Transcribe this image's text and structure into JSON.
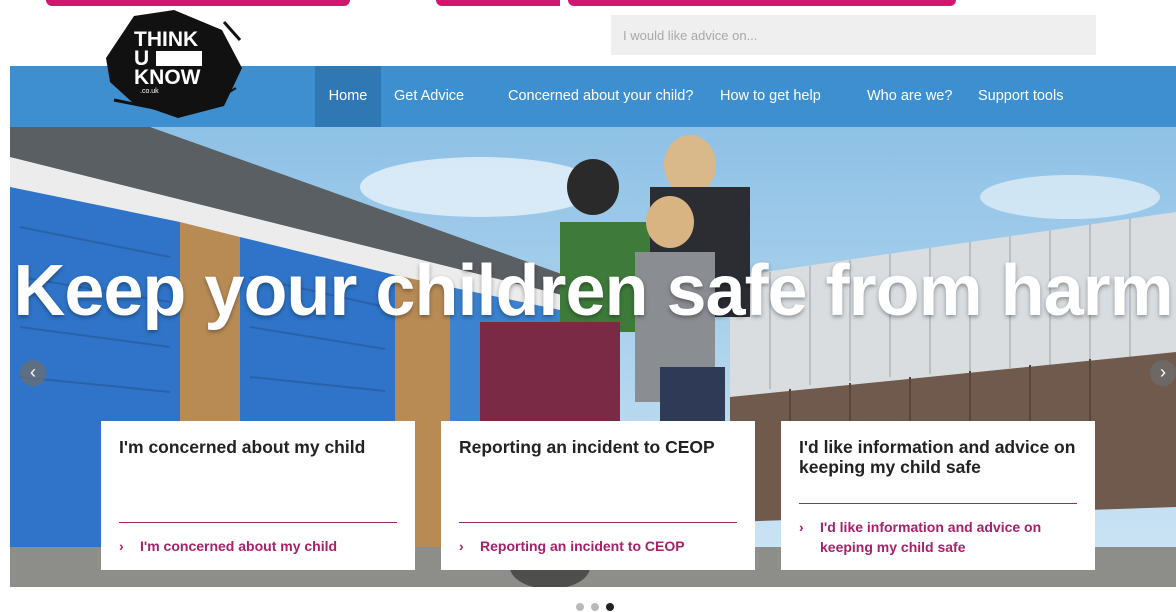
{
  "colors": {
    "nav_bg": "#3d8fd0",
    "nav_active": "#2f78b3",
    "accent": "#a6206a",
    "brand_pink": "#d0166f"
  },
  "logo": {
    "line1": "THINK",
    "line2": "U",
    "line3": "KNOW",
    "domain": ".co.uk",
    "icon": "thinkuknow-logo"
  },
  "search": {
    "placeholder": "I would like advice on..."
  },
  "nav": {
    "items": [
      {
        "label": "Home",
        "active": true
      },
      {
        "label": "Get Advice"
      },
      {
        "label": "Concerned about your child?"
      },
      {
        "label": "How to get help"
      },
      {
        "label": "Who are we?"
      },
      {
        "label": "Support tools"
      }
    ]
  },
  "hero": {
    "title": "Keep your children safe from harm",
    "prev_icon": "chevron-left-icon",
    "next_icon": "chevron-right-icon",
    "prev_glyph": "‹",
    "next_glyph": "›"
  },
  "cards": [
    {
      "title": "I'm concerned about my child",
      "link": "I'm concerned about my child"
    },
    {
      "title": "Reporting an incident to CEOP",
      "link": "Reporting an incident to CEOP"
    },
    {
      "title": "I'd like information and advice on keeping my child safe",
      "link": "I'd like information and advice on keeping my child safe"
    }
  ],
  "link_chevron": "›",
  "carousel": {
    "slides": 3,
    "active_slide": 3
  }
}
